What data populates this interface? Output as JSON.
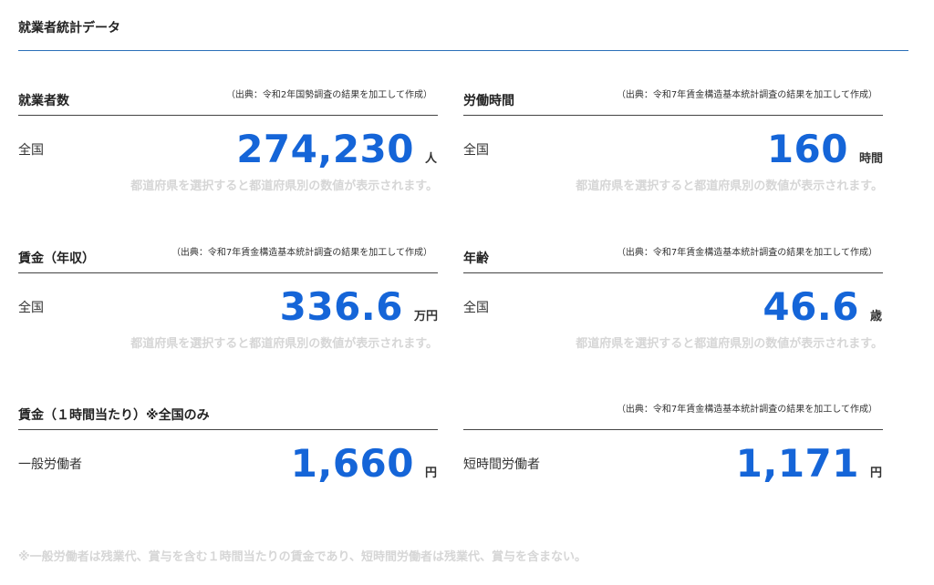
{
  "section": {
    "title": "就業者統計データ"
  },
  "cards": [
    {
      "title": "就業者数",
      "source": "（出典：令和2年国勢調査の結果を加工して作成）",
      "label": "全国",
      "value": "274,230",
      "unit": "人",
      "hint": "都道府県を選択すると都道府県別の数値が表示されます。"
    },
    {
      "title": "労働時間",
      "source": "（出典：令和7年賃金構造基本統計調査の結果を加工して作成）",
      "label": "全国",
      "value": "160",
      "unit": "時間",
      "hint": "都道府県を選択すると都道府県別の数値が表示されます。"
    },
    {
      "title": "賃金（年収）",
      "source": "（出典：令和7年賃金構造基本統計調査の結果を加工して作成）",
      "label": "全国",
      "value": "336.6",
      "unit": "万円",
      "hint": "都道府県を選択すると都道府県別の数値が表示されます。"
    },
    {
      "title": "年齢",
      "source": "（出典：令和7年賃金構造基本統計調査の結果を加工して作成）",
      "label": "全国",
      "value": "46.6",
      "unit": "歳",
      "hint": "都道府県を選択すると都道府県別の数値が表示されます。"
    },
    {
      "title": "賃金（１時間当たり）※全国のみ",
      "label": "一般労働者",
      "value": "1,660",
      "unit": "円"
    },
    {
      "source": "（出典：令和7年賃金構造基本統計調査の結果を加工して作成）",
      "label": "短時間労働者",
      "value": "1,171",
      "unit": "円"
    }
  ],
  "footnote": "※一般労働者は残業代、賞与を含む１時間当たりの賃金であり、短時間労働者は残業代、賞与を含まない。"
}
